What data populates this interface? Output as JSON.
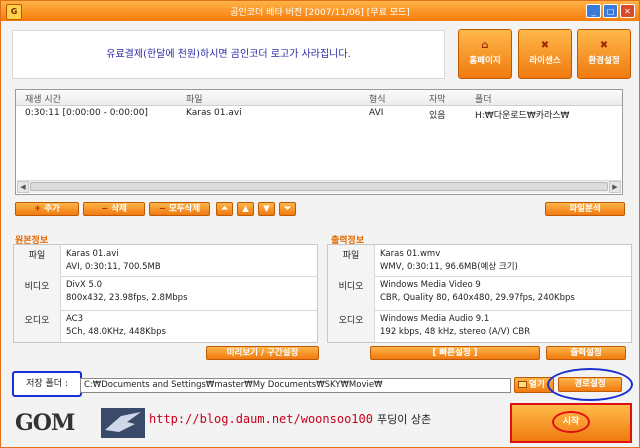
{
  "window": {
    "title": "곰인코더 베타 버전 [2007/11/06] [무료 모드]",
    "app_icon": "gom-icon"
  },
  "notice": {
    "text": "유료결제(한달에 천원)하시면 곰인코더 로고가 사라집니다."
  },
  "top_buttons": [
    {
      "label": "홈페이지",
      "icon": "home-icon"
    },
    {
      "label": "라이센스",
      "icon": "license-icon"
    },
    {
      "label": "환경설정",
      "icon": "settings-icon"
    }
  ],
  "file_list": {
    "columns": [
      "재생 시간",
      "파일",
      "형식",
      "자막",
      "폴더"
    ],
    "rows": [
      {
        "duration": "0:30:11 [0:00:00 - 0:00:00]",
        "file": "Karas 01.avi",
        "format": "AVI",
        "subtitle": "있음",
        "folder": "H:₩다운로드₩카라스₩"
      }
    ]
  },
  "list_buttons": {
    "add": "추가",
    "delete": "삭제",
    "delete_all": "모두삭제",
    "analyze": "파일분석"
  },
  "source_info": {
    "heading": "원본정보",
    "rows": [
      {
        "label": "파일",
        "line1": "Karas 01.avi",
        "line2": "AVI, 0:30:11, 700.5MB"
      },
      {
        "label": "비디오",
        "line1": "DivX 5.0",
        "line2": "800x432, 23.98fps, 2.8Mbps"
      },
      {
        "label": "오디오",
        "line1": "AC3",
        "line2": "5Ch, 48.0KHz, 448Kbps"
      }
    ]
  },
  "output_info": {
    "heading": "출력정보",
    "rows": [
      {
        "label": "파일",
        "line1": "Karas 01.wmv",
        "line2": "WMV, 0:30:11, 96.6MB(예상 크기)"
      },
      {
        "label": "비디오",
        "line1": "Windows Media Video 9",
        "line2": "CBR, Quality 80, 640x480, 29.97fps, 240Kbps"
      },
      {
        "label": "오디오",
        "line1": "Windows Media Audio 9.1",
        "line2": "192 kbps, 48 kHz, stereo (A/V) CBR"
      }
    ]
  },
  "preview_button": "미리보기 / 구간설정",
  "quick_settings_button": "[ 빠른설정 ]",
  "output_settings_button": "출력설정",
  "save": {
    "label": "저장 폴더 :",
    "path": "C:₩Documents and Settings₩master₩My Documents₩SKY₩Movie₩",
    "open_button": "열기",
    "path_button": "경로설정"
  },
  "footer": {
    "logo_text": "GOM",
    "url": "http://blog.daum.net/woonsoo100",
    "tagline": "푸딩이 상촌"
  },
  "start_button": "시작",
  "colors": {
    "accent_orange": "#f57c0a",
    "highlight_blue": "#1a2fd0",
    "highlight_red": "#e01010",
    "notice_text": "#2a2aa8"
  }
}
